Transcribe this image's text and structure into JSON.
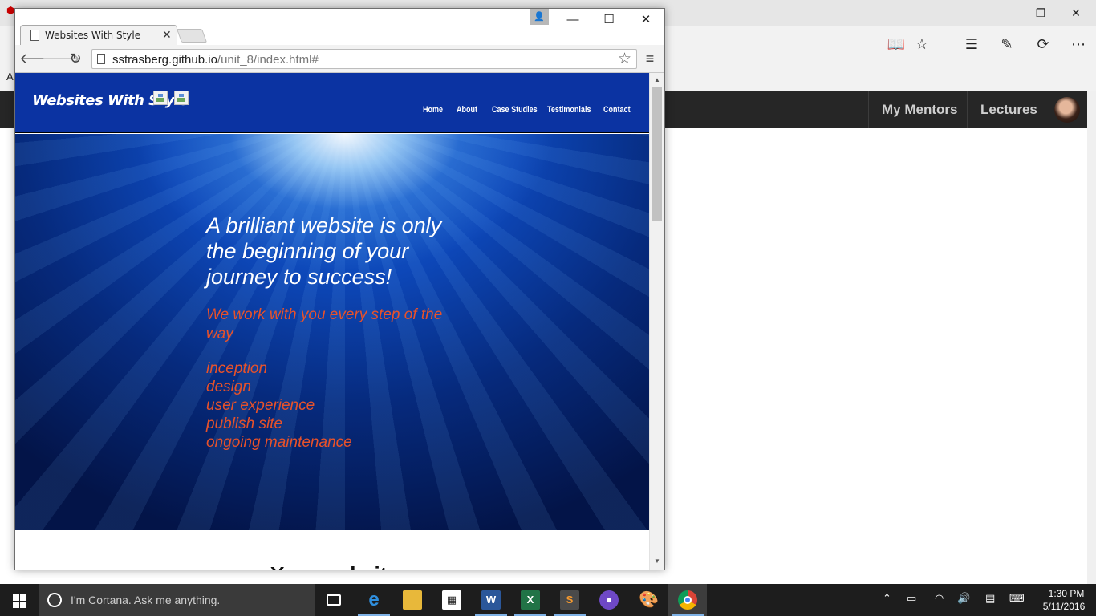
{
  "edge": {
    "nav_items": [
      "My Mentors",
      "Lectures"
    ],
    "favbar_fragment": "A",
    "window_controls": {
      "minimize": "—",
      "restore": "❐",
      "close": "✕"
    },
    "toolbar_icons": [
      "reading-view-icon",
      "favorites-star-icon",
      "hub-icon",
      "web-note-icon",
      "share-icon",
      "more-icon"
    ]
  },
  "chrome": {
    "tab_title": "Websites With Style",
    "tab_close": "✕",
    "url_host": "sstrasberg.github.io",
    "url_path": "/unit_8/index.html#",
    "window_controls": {
      "minimize": "—",
      "maximize": "☐",
      "close": "✕"
    }
  },
  "site": {
    "logo": "Websites With Style",
    "nav": [
      "Home",
      "About",
      "Case Studies",
      "Testimonials",
      "Contact"
    ],
    "hero_title": "A brilliant website is only the beginning of your journey to success!",
    "hero_sub": "We work with you every step of the way",
    "steps": [
      "inception",
      "design",
      "user experience",
      "publish site",
      "ongoing maintenance"
    ],
    "below_heading": "Your website"
  },
  "taskbar": {
    "cortana_placeholder": "I'm Cortana. Ask me anything.",
    "apps": [
      "task-view",
      "edge",
      "file-explorer",
      "store",
      "word",
      "excel",
      "sublime-text",
      "github",
      "paint",
      "chrome"
    ],
    "time": "1:30 PM",
    "date": "5/11/2016"
  }
}
